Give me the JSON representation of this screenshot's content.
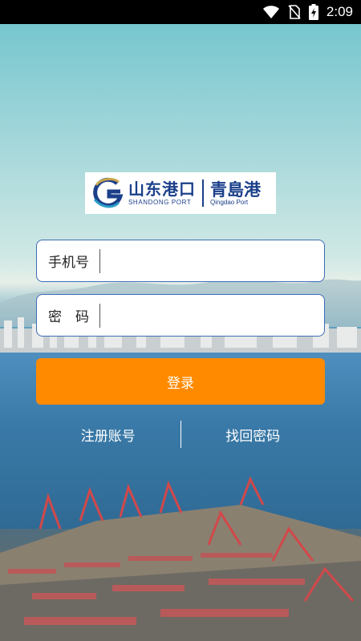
{
  "status_bar": {
    "time": "2:09",
    "icons": [
      "wifi-icon",
      "no-sim-icon",
      "battery-charging-icon"
    ]
  },
  "logo": {
    "left_cn": "山东港口",
    "left_en": "SHANDONG PORT",
    "right_cn": "青島港",
    "right_en": "Qingdao Port"
  },
  "form": {
    "phone_label": "手机号",
    "phone_value": "",
    "password_label": "密　码",
    "password_value": ""
  },
  "actions": {
    "login_label": "登录",
    "register_label": "注册账号",
    "forgot_label": "找回密码"
  },
  "colors": {
    "primary_button": "#ff8a00",
    "input_border": "#3d6cb6",
    "brand_blue": "#1b3f8a"
  }
}
